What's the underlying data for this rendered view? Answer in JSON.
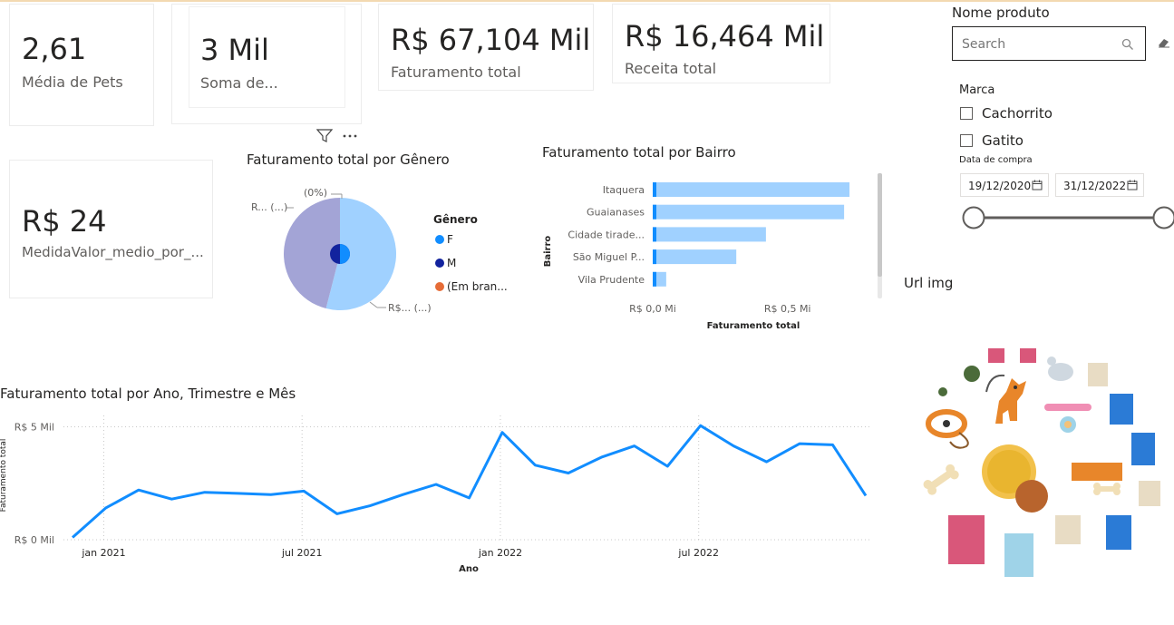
{
  "kpis": {
    "pets": {
      "value": "2,61",
      "label": "Média de Pets"
    },
    "soma": {
      "value": "3 Mil",
      "label": "Soma de..."
    },
    "faturamento": {
      "value": "R$ 67,104 Mil",
      "label": "Faturamento total"
    },
    "receita": {
      "value": "R$ 16,464 Mil",
      "label": "Receita total"
    },
    "medio": {
      "value": "R$ 24",
      "label": "MedidaValor_medio_por_..."
    }
  },
  "slicer_produto": {
    "title": "Nome produto",
    "search_placeholder": "Search"
  },
  "slicer_marca": {
    "title": "Marca",
    "options": [
      "Cachorrito",
      "Gatito"
    ]
  },
  "slicer_data": {
    "title": "Data de compra",
    "start": "19/12/2020",
    "end": "31/12/2022"
  },
  "url_img": {
    "title": "Url img"
  },
  "pie_labels": {
    "top": "(0%)",
    "left": "R... (...)",
    "right": "R$... (...)"
  },
  "colors": {
    "f": "#118dff",
    "m": "#12239e",
    "em_branco": "#e66c37",
    "bar": "#a0d1ff",
    "bar_tip": "#118dff",
    "line": "#118dff"
  },
  "chart_data": [
    {
      "type": "pie",
      "title": "Faturamento total por Gênero",
      "legend_title": "Gênero",
      "legend_position": "right",
      "slices": [
        {
          "name": "F",
          "value": 54,
          "color": "#a0d1ff"
        },
        {
          "name": "M",
          "value": 46,
          "color": "#a3a4d6"
        },
        {
          "name": "(Em bran...",
          "value": 0,
          "color": "#e66c37"
        }
      ],
      "legend": [
        {
          "name": "F",
          "color": "#118dff"
        },
        {
          "name": "M",
          "color": "#12239e"
        },
        {
          "name": "(Em bran...",
          "color": "#e66c37"
        }
      ]
    },
    {
      "type": "bar",
      "orientation": "horizontal",
      "title": "Faturamento total por Bairro",
      "xlabel": "Faturamento total",
      "ylabel": "Bairro",
      "categories": [
        "Itaquera",
        "Guaianases",
        "Cidade tirade...",
        "São Miguel P...",
        "Vila Prudente"
      ],
      "values": [
        0.73,
        0.71,
        0.42,
        0.31,
        0.05
      ],
      "xticks": [
        "R$ 0,0 Mi",
        "R$ 0,5 Mi"
      ],
      "xlim": [
        0,
        0.75
      ]
    },
    {
      "type": "line",
      "title": "Faturamento total por Ano, Trimestre e Mês",
      "xlabel": "Ano",
      "ylabel": "Faturamento total",
      "xticks": [
        "jan 2021",
        "jul 2021",
        "jan 2022",
        "jul 2022"
      ],
      "yticks": [
        "R$ 5 Mil",
        "R$ 0 Mil"
      ],
      "ylim": [
        0,
        5.5
      ],
      "x": [
        "dez 2020",
        "jan 2021",
        "fev 2021",
        "mar 2021",
        "abr 2021",
        "mai 2021",
        "jun 2021",
        "jul 2021",
        "ago 2021",
        "set 2021",
        "out 2021",
        "nov 2021",
        "dez 2021",
        "jan 2022",
        "fev 2022",
        "mar 2022",
        "abr 2022",
        "mai 2022",
        "jun 2022",
        "jul 2022",
        "ago 2022",
        "set 2022",
        "out 2022",
        "nov 2022",
        "dez 2022"
      ],
      "values": [
        0.1,
        1.4,
        2.2,
        1.8,
        2.1,
        2.05,
        2.0,
        2.15,
        1.15,
        1.5,
        2.0,
        2.45,
        1.85,
        4.75,
        3.3,
        2.95,
        3.65,
        4.15,
        3.25,
        5.05,
        4.15,
        3.45,
        4.25,
        4.2,
        1.95
      ],
      "grid": true
    }
  ]
}
